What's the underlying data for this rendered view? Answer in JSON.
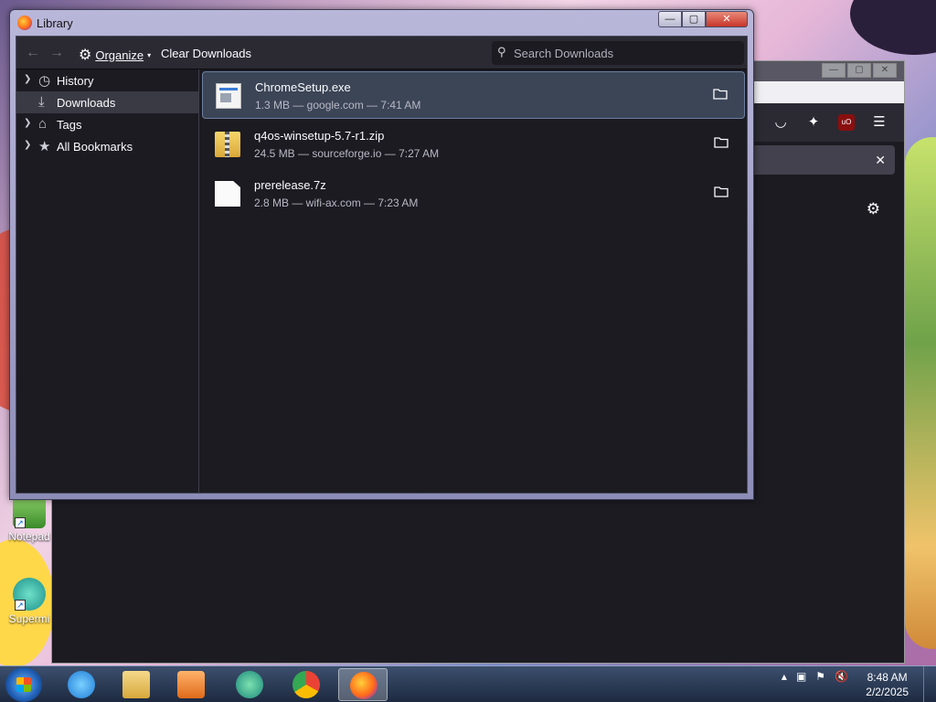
{
  "desktop": {
    "icons": [
      {
        "label": "Notepad"
      },
      {
        "label": "Supermi"
      }
    ]
  },
  "library": {
    "title": "Library",
    "toolbar": {
      "organize_label": "Organize",
      "clear_downloads_label": "Clear Downloads",
      "search_placeholder": "Search Downloads"
    },
    "sidebar": [
      {
        "label": "History",
        "icon": "clock-icon",
        "selected": false
      },
      {
        "label": "Downloads",
        "icon": "download-icon",
        "selected": true
      },
      {
        "label": "Tags",
        "icon": "tag-icon",
        "selected": false
      },
      {
        "label": "All Bookmarks",
        "icon": "star-icon",
        "selected": false
      }
    ],
    "downloads": [
      {
        "name": "ChromeSetup.exe",
        "meta": "1.3 MB — google.com — 7:41 AM",
        "icon": "exe-file-icon",
        "selected": true
      },
      {
        "name": "q4os-winsetup-5.7-r1.zip",
        "meta": "24.5 MB — sourceforge.io — 7:27 AM",
        "icon": "zip-file-icon",
        "selected": false
      },
      {
        "name": "prerelease.7z",
        "meta": "2.8 MB — wifi-ax.com — 7:23 AM",
        "icon": "generic-file-icon",
        "selected": false
      }
    ]
  },
  "taskbar": {
    "clock_time": "8:48 AM",
    "clock_date": "2/2/2025",
    "apps": [
      "internet-explorer-icon",
      "file-explorer-icon",
      "media-player-icon",
      "edge-icon",
      "chrome-icon",
      "firefox-icon"
    ]
  }
}
